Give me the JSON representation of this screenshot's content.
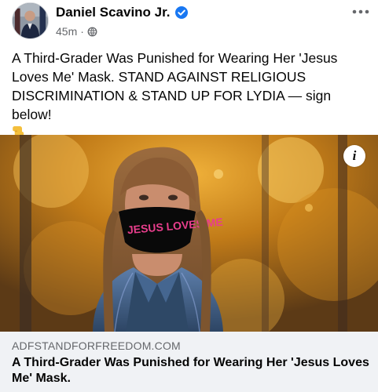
{
  "post": {
    "author": "Daniel Scavino Jr.",
    "timestamp": "45m",
    "separator": "·",
    "audience_icon": "globe-icon",
    "verified_icon": "verified-badge-icon",
    "more_icon": "more-options-icon",
    "text": "A Third-Grader Was Punished for Wearing Her 'Jesus Loves Me' Mask. STAND AGAINST RELIGIOUS DISCRIMINATION & STAND UP FOR LYDIA — sign below!",
    "emoji": "point-down-emoji"
  },
  "link": {
    "image_mask_text": "JESUS LOVES ME",
    "info_label": "i",
    "domain": "ADFSTANDFORFREEDOM.COM",
    "title": "A Third-Grader Was Punished for Wearing Her 'Jesus Loves Me' Mask."
  },
  "colors": {
    "text_primary": "#050505",
    "text_secondary": "#65676b",
    "verified_blue": "#1877f2",
    "preview_background": "#f0f2f5",
    "mask_text_pink": "#e83e8c"
  }
}
